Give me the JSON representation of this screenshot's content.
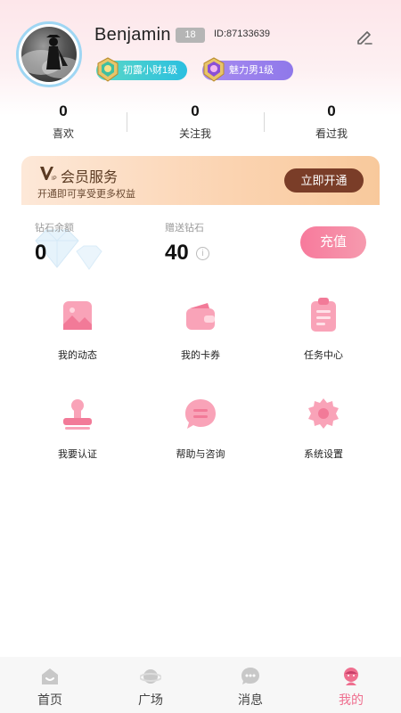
{
  "profile": {
    "name": "Benjamin",
    "age": "18",
    "id_text": "ID:87133639",
    "wealth_badge": "初露小财1级",
    "charm_badge": "魅力男1级"
  },
  "stats": [
    {
      "value": "0",
      "label": "喜欢"
    },
    {
      "value": "0",
      "label": "关注我"
    },
    {
      "value": "0",
      "label": "看过我"
    }
  ],
  "vip": {
    "title": "会员服务",
    "subtitle": "开通即可享受更多权益",
    "button": "立即开通"
  },
  "wallet": {
    "balance_label": "钻石余额",
    "balance_value": "0",
    "gift_label": "赠送钻石",
    "gift_value": "40",
    "recharge_button": "充值"
  },
  "menu": [
    {
      "label": "我的动态",
      "icon": "image-icon"
    },
    {
      "label": "我的卡券",
      "icon": "wallet-icon"
    },
    {
      "label": "任务中心",
      "icon": "clipboard-icon"
    },
    {
      "label": "我要认证",
      "icon": "stamp-icon"
    },
    {
      "label": "帮助与咨询",
      "icon": "chat-bubble-icon"
    },
    {
      "label": "系统设置",
      "icon": "gear-icon"
    }
  ],
  "tabs": [
    {
      "label": "首页",
      "icon": "home-icon"
    },
    {
      "label": "广场",
      "icon": "planet-icon"
    },
    {
      "label": "消息",
      "icon": "message-icon"
    },
    {
      "label": "我的",
      "icon": "profile-icon",
      "active": true
    }
  ],
  "colors": {
    "accent": "#ef6f8f",
    "vip_button": "#7a3d28",
    "icon_pink": "#f9a3b8"
  }
}
